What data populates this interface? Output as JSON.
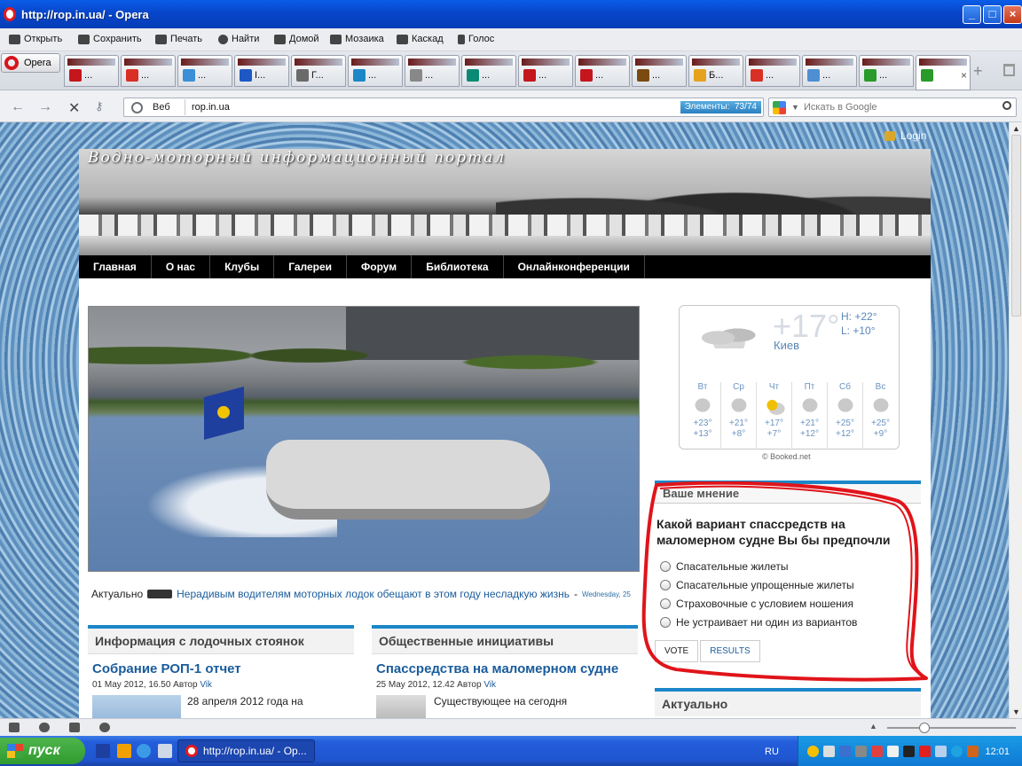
{
  "window": {
    "title": "http://rop.in.ua/ - Opera"
  },
  "toolbar": [
    "Открыть",
    "Сохранить",
    "Печать",
    "Найти",
    "Домой",
    "Мозаика",
    "Каскад",
    "Голос"
  ],
  "tabbar": {
    "opera_menu": "Opera",
    "tabs": [
      {
        "label": "...",
        "color": "#c4161c"
      },
      {
        "label": "...",
        "color": "#d93025"
      },
      {
        "label": "...",
        "color": "#3a8fd6"
      },
      {
        "label": "I...",
        "color": "#1d58c4"
      },
      {
        "label": "Г...",
        "color": "#6a6a6a"
      },
      {
        "label": "...",
        "color": "#1b87c8"
      },
      {
        "label": "...",
        "color": "#888888"
      },
      {
        "label": "...",
        "color": "#0a8a74"
      },
      {
        "label": "...",
        "color": "#c4161c"
      },
      {
        "label": "...",
        "color": "#c4161c"
      },
      {
        "label": "...",
        "color": "#7a4a10"
      },
      {
        "label": "Б...",
        "color": "#e5a21c"
      },
      {
        "label": "...",
        "color": "#d93025"
      },
      {
        "label": "...",
        "color": "#4d8fd1"
      },
      {
        "label": "...",
        "color": "#2a9a2a"
      },
      {
        "label": "",
        "color": "#2a9a2a"
      }
    ]
  },
  "address": {
    "web_label": "Веб",
    "url": "rop.in.ua",
    "elements": "Элементы:",
    "elements_count": "73/74",
    "search_placeholder": "Искать в Google"
  },
  "site": {
    "login": "Login",
    "header_title": "Водно-моторный информационный портал",
    "menu": [
      "Главная",
      "О нас",
      "Клубы",
      "Галереи",
      "Форум",
      "Библиотека",
      "Онлайнконференции"
    ],
    "ticker": {
      "label": "Актуально",
      "headline": "Нерадивым водителям моторных лодок обещают в этом году несладкую жизнь",
      "dash": "-",
      "date": "Wednesday, 25"
    },
    "sections": [
      {
        "title": "Информация с лодочных стоянок",
        "post_title": "Собрание РОП-1 отчет",
        "meta": "01 May 2012, 16.50 Автор",
        "author": "Vik",
        "excerpt": "28 апреля 2012 года на"
      },
      {
        "title": "Общественные инициативы",
        "post_title": "Спассредства на маломерном судне",
        "meta": "25 May 2012, 12.42 Автор",
        "author": "Vik",
        "excerpt": "Существующее на сегодня"
      }
    ],
    "weather": {
      "current_temp": "+17°",
      "high": "H: +22°",
      "low": "L: +10°",
      "city": "Киев",
      "days": [
        {
          "name": "Вт",
          "hi": "+23°",
          "lo": "+13°",
          "icon": "cloud-rain-icon"
        },
        {
          "name": "Ср",
          "hi": "+21°",
          "lo": "+8°",
          "icon": "cloud-rain-icon"
        },
        {
          "name": "Чт",
          "hi": "+17°",
          "lo": "+7°",
          "icon": "sun-cloud-icon"
        },
        {
          "name": "Пт",
          "hi": "+21°",
          "lo": "+12°",
          "icon": "cloud-icon"
        },
        {
          "name": "Сб",
          "hi": "+25°",
          "lo": "+12°",
          "icon": "cloud-rain-icon"
        },
        {
          "name": "Вс",
          "hi": "+25°",
          "lo": "+9°",
          "icon": "cloud-rain-icon"
        }
      ],
      "credit": "© Booked.net"
    },
    "poll": {
      "title": "Ваше мнение",
      "question": "Какой вариант спассредств на маломерном судне Вы бы предпочли",
      "options": [
        "Спасательные жилеты",
        "Спасательные упрощенные жилеты",
        "Страховочные с условием ношения",
        "Не устраивает ни один из вариантов"
      ],
      "vote": "VOTE",
      "results": "RESULTS"
    },
    "aktual_title": "Актуально"
  },
  "taskbar": {
    "start": "пуск",
    "task": "http://rop.in.ua/ - Op...",
    "lang": "RU",
    "clock": "12:01"
  },
  "colors": {
    "accent": "#1b87c8",
    "link": "#1a5c9c",
    "menu_bg": "#000000",
    "annotation": "#e0141a"
  }
}
